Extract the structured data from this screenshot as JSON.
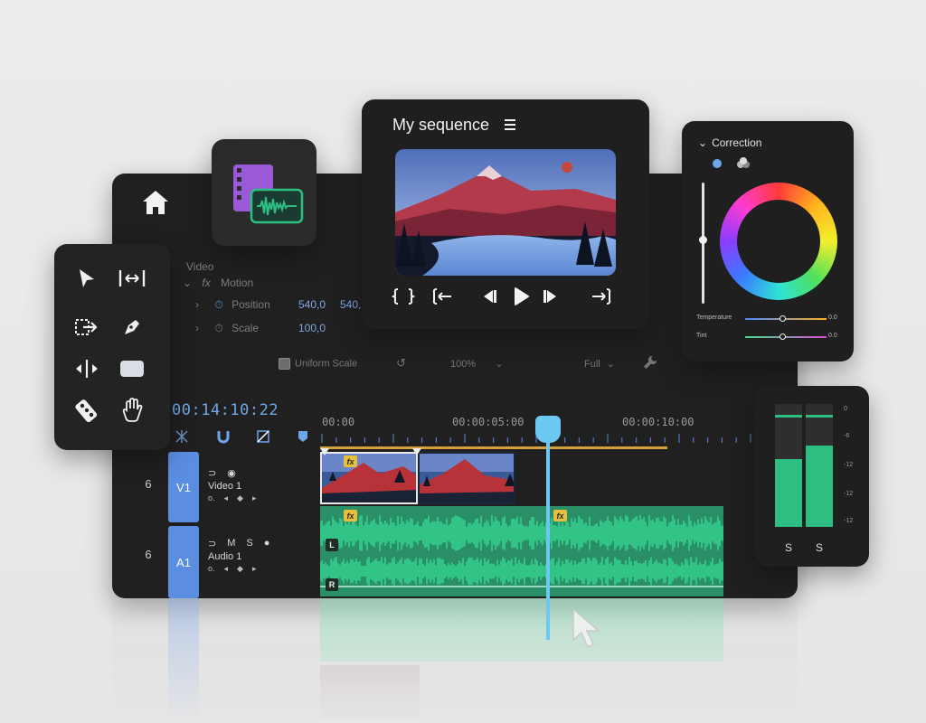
{
  "main": {
    "home_icon": "home-icon",
    "props": {
      "section": "Video",
      "effect": "Motion",
      "fx_symbol": "fx",
      "position_label": "Position",
      "position_x": "540,0",
      "position_y": "540,",
      "scale_label": "Scale",
      "scale_value": "100,0",
      "uniform_scale": "Uniform Scale",
      "zoom": "100%",
      "quality": "Full"
    },
    "timecode": "00:14:10:22",
    "ruler_labels": [
      "00:00",
      "00:00:05:00",
      "00:00:10:00"
    ],
    "tracks": [
      {
        "id": "V1",
        "num": "6",
        "name": "Video 1"
      },
      {
        "id": "A1",
        "num": "6",
        "name": "Audio 1",
        "m": "M",
        "s": "S"
      }
    ],
    "badges": {
      "fx": "fx",
      "left": "L",
      "right": "R"
    }
  },
  "monitor": {
    "title": "My sequence",
    "controls": [
      "mark-in-out-icon",
      "go-to-in-icon",
      "step-back-icon",
      "play-icon",
      "step-forward-icon",
      "go-to-out-icon"
    ]
  },
  "color_panel": {
    "title": "Correction",
    "sliders": [
      {
        "label": "Temperature",
        "value": "0.0",
        "level": 0.45
      },
      {
        "label": "Tint",
        "value": "0.0",
        "level": 0.45
      }
    ]
  },
  "meter": {
    "db_labels": [
      "0",
      "-6",
      "-12",
      "-12",
      "-12"
    ],
    "channels": [
      {
        "label": "S",
        "level": 0.55
      },
      {
        "label": "S",
        "level": 0.66
      }
    ]
  },
  "colors": {
    "accent_blue": "#5b8de0",
    "playhead": "#6cc8f0",
    "audio_green": "#2dbf82",
    "fx_yellow": "#e8bf3a"
  }
}
